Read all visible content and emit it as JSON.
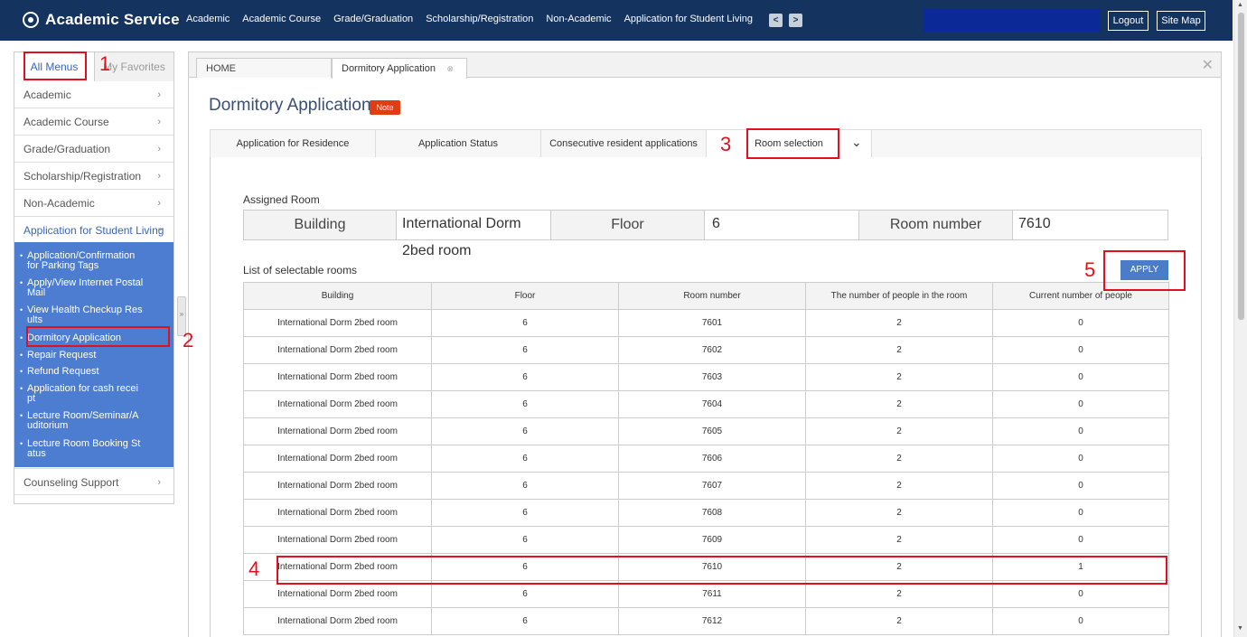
{
  "brand": {
    "title": "Academic Service"
  },
  "topnav": [
    "Academic",
    "Academic Course",
    "Grade/Graduation",
    "Scholarship/Registration",
    "Non-Academic",
    "Application for Student Living"
  ],
  "topbar": {
    "logout": "Logout",
    "sitemap": "Site Map",
    "prev": "<",
    "next": ">"
  },
  "sidebar": {
    "tab_all": "All Menus",
    "tab_fav": "My Favorites",
    "items": [
      "Academic",
      "Academic Course",
      "Grade/Graduation",
      "Scholarship/Registration",
      "Non-Academic",
      "Application for Student Living",
      "Counseling Support"
    ],
    "subitems": [
      [
        "Application/Confirmation",
        "for Parking Tags"
      ],
      [
        "Apply/View Internet Postal",
        "Mail"
      ],
      [
        "View Health Checkup Res",
        "ults"
      ],
      [
        "Dormitory Application"
      ],
      [
        "Repair Request"
      ],
      [
        "Refund Request"
      ],
      [
        "Application for cash recei",
        "pt"
      ],
      [
        "Lecture Room/Seminar/A",
        "uditorium"
      ],
      [
        "Lecture Room Booking St",
        "atus"
      ]
    ],
    "chev": "›",
    "chev_open": "⌄",
    "handle_icon": "»"
  },
  "pagetabs": {
    "home": "HOME",
    "current": "Dormitory Application",
    "close": "✕",
    "tab_close": "⊗"
  },
  "page": {
    "title": "Dormitory Application",
    "note": "Note",
    "subtabs": [
      "Application for Residence",
      "Application Status",
      "Consecutive resident applications",
      "Room selection"
    ],
    "subtab_more": "⌄"
  },
  "assigned": {
    "heading": "Assigned Room",
    "building_label": "Building",
    "building_value": "International Dorm 2bed room",
    "floor_label": "Floor",
    "floor_value": "6",
    "room_label": "Room number",
    "room_value": "7610"
  },
  "list": {
    "heading": "List of selectable rooms",
    "apply": "APPLY",
    "columns": [
      "Building",
      "Floor",
      "Room number",
      "The number of people in the room",
      "Current number of people"
    ],
    "rows": [
      [
        "International Dorm 2bed room",
        "6",
        "7601",
        "2",
        "0"
      ],
      [
        "International Dorm 2bed room",
        "6",
        "7602",
        "2",
        "0"
      ],
      [
        "International Dorm 2bed room",
        "6",
        "7603",
        "2",
        "0"
      ],
      [
        "International Dorm 2bed room",
        "6",
        "7604",
        "2",
        "0"
      ],
      [
        "International Dorm 2bed room",
        "6",
        "7605",
        "2",
        "0"
      ],
      [
        "International Dorm 2bed room",
        "6",
        "7606",
        "2",
        "0"
      ],
      [
        "International Dorm 2bed room",
        "6",
        "7607",
        "2",
        "0"
      ],
      [
        "International Dorm 2bed room",
        "6",
        "7608",
        "2",
        "0"
      ],
      [
        "International Dorm 2bed room",
        "6",
        "7609",
        "2",
        "0"
      ],
      [
        "International Dorm 2bed room",
        "6",
        "7610",
        "2",
        "1"
      ],
      [
        "International Dorm 2bed room",
        "6",
        "7611",
        "2",
        "0"
      ],
      [
        "International Dorm 2bed room",
        "6",
        "7612",
        "2",
        "0"
      ]
    ]
  },
  "annotations": [
    "1",
    "2",
    "3",
    "4",
    "5"
  ],
  "scroll": {
    "up": "▲",
    "down": "▼"
  }
}
